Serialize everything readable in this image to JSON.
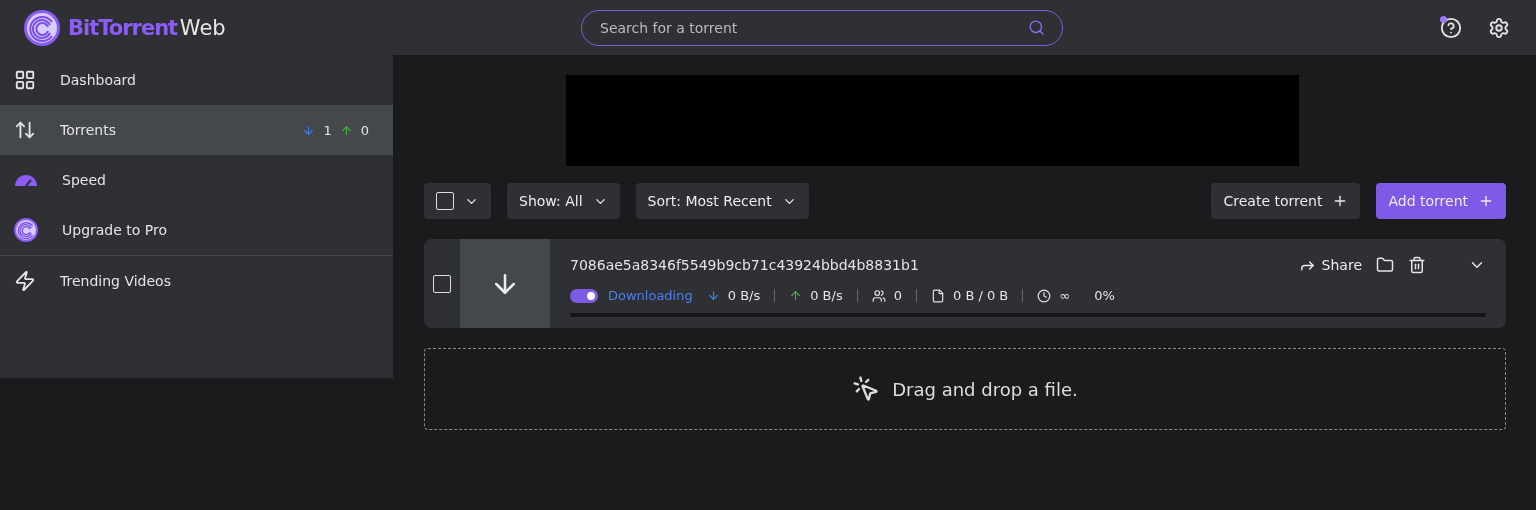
{
  "header": {
    "brand_bold": "BitTorrent",
    "brand_light": "Web",
    "search": {
      "placeholder": "Search for a torrent"
    },
    "help_unread": true
  },
  "sidebar": {
    "items": [
      {
        "kind": "dashboard",
        "label": "Dashboard",
        "selected": false
      },
      {
        "kind": "torrents",
        "label": "Torrents",
        "selected": true,
        "down_count": "1",
        "up_count": "0"
      },
      {
        "kind": "speed",
        "label": "Speed",
        "selected": false
      },
      {
        "kind": "pro",
        "label": "Upgrade to Pro",
        "selected": false
      },
      {
        "kind": "trending",
        "label": "Trending Videos",
        "selected": false
      }
    ]
  },
  "toolbar": {
    "select_all": {
      "checked": false
    },
    "show": {
      "label": "Show:",
      "value": "All"
    },
    "sort": {
      "label": "Sort:",
      "value": "Most Recent"
    },
    "create_button": "Create torrent",
    "add_button": "Add torrent"
  },
  "torrents": [
    {
      "name": "7086ae5a8346f5549b9cb71c43924bbd4b8831b1",
      "checked": false,
      "on": true,
      "status": "Downloading",
      "down_speed": "0 B/s",
      "up_speed": "0 B/s",
      "peers": "0",
      "size": "0 B / 0 B",
      "eta": "∞",
      "percent": "0%",
      "level": 0,
      "share": "Share"
    }
  ],
  "dropzone": {
    "text": "Drag and drop a file."
  }
}
